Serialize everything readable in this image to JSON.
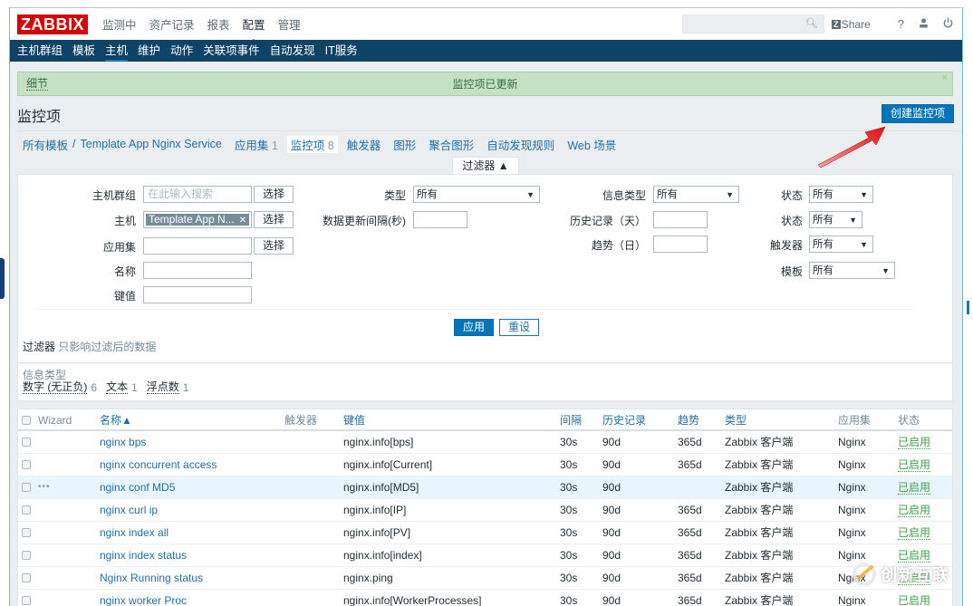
{
  "header": {
    "logo": "ZABBIX",
    "main_menu": [
      "监测中",
      "资产记录",
      "报表",
      "配置",
      "管理"
    ],
    "active_main": "配置",
    "search_placeholder": "",
    "share_label": "Share",
    "share_badge": "Z",
    "help_label": "?"
  },
  "subnav": {
    "items": [
      "主机群组",
      "模板",
      "主机",
      "维护",
      "动作",
      "关联项事件",
      "自动发现",
      "IT服务"
    ],
    "active": "主机"
  },
  "message": {
    "details_label": "细节",
    "text": "监控项已更新",
    "close": "×"
  },
  "page": {
    "title": "监控项",
    "create_button": "创建监控项"
  },
  "breadcrumb": {
    "all_templates": "所有模板",
    "separator": "/",
    "template": "Template App Nginx Service",
    "tabs": [
      {
        "label": "应用集",
        "count": "1"
      },
      {
        "label": "监控项",
        "count": "8",
        "current": true
      },
      {
        "label": "触发器",
        "count": ""
      },
      {
        "label": "图形",
        "count": ""
      },
      {
        "label": "聚合图形",
        "count": ""
      },
      {
        "label": "自动发现规则",
        "count": ""
      },
      {
        "label": "Web 场景",
        "count": ""
      }
    ]
  },
  "filter": {
    "tab_label": "过滤器 ▲",
    "host_group_label": "主机群组",
    "host_group_placeholder": "在此输入搜索",
    "select_label": "选择",
    "host_label": "主机",
    "host_chip": "Template App N...",
    "application_label": "应用集",
    "name_label": "名称",
    "key_label": "键值",
    "type_label": "类型",
    "type_value": "所有",
    "interval_label": "数据更新间隔(秒)",
    "info_type_label": "信息类型",
    "info_type_value": "所有",
    "history_label": "历史记录（天）",
    "trends_label": "趋势（日）",
    "state_label": "状态",
    "state_value": "所有",
    "status_label": "状态",
    "status_value": "所有",
    "triggers_label": "触发器",
    "triggers_value": "所有",
    "template_label": "模板",
    "template_value": "所有",
    "apply_label": "应用",
    "reset_label": "重设",
    "note_a": "过滤器",
    "note_b": "只影响过滤后的数据"
  },
  "info_type_summary": {
    "title": "信息类型",
    "items": [
      {
        "label": "数字 (无正负)",
        "count": "6"
      },
      {
        "label": "文本",
        "count": "1"
      },
      {
        "label": "浮点数",
        "count": "1"
      }
    ]
  },
  "table": {
    "columns": {
      "wizard": "Wizard",
      "name": "名称▲",
      "triggers": "触发器",
      "key": "键值",
      "interval": "间隔",
      "history": "历史记录",
      "trends": "趋势",
      "type": "类型",
      "applications": "应用集",
      "status": "状态"
    },
    "rows": [
      {
        "wizard": "",
        "name": "nginx bps",
        "triggers": "",
        "key": "nginx.info[bps]",
        "interval": "30s",
        "history": "90d",
        "trends": "365d",
        "type": "Zabbix 客户端",
        "applications": "Nginx",
        "status": "已启用"
      },
      {
        "wizard": "",
        "name": "nginx concurrent access",
        "triggers": "",
        "key": "nginx.info[Current]",
        "interval": "30s",
        "history": "90d",
        "trends": "365d",
        "type": "Zabbix 客户端",
        "applications": "Nginx",
        "status": "已启用"
      },
      {
        "wizard": "•••",
        "name": "nginx conf MD5",
        "triggers": "",
        "key": "nginx.info[MD5]",
        "interval": "30s",
        "history": "90d",
        "trends": "",
        "type": "Zabbix 客户端",
        "applications": "Nginx",
        "status": "已启用",
        "highlighted": true
      },
      {
        "wizard": "",
        "name": "nginx curl ip",
        "triggers": "",
        "key": "nginx.info[IP]",
        "interval": "30s",
        "history": "90d",
        "trends": "365d",
        "type": "Zabbix 客户端",
        "applications": "Nginx",
        "status": "已启用"
      },
      {
        "wizard": "",
        "name": "nginx index all",
        "triggers": "",
        "key": "nginx.info[PV]",
        "interval": "30s",
        "history": "90d",
        "trends": "365d",
        "type": "Zabbix 客户端",
        "applications": "Nginx",
        "status": "已启用"
      },
      {
        "wizard": "",
        "name": "nginx index status",
        "triggers": "",
        "key": "nginx.info[index]",
        "interval": "30s",
        "history": "90d",
        "trends": "365d",
        "type": "Zabbix 客户端",
        "applications": "Nginx",
        "status": "已启用"
      },
      {
        "wizard": "",
        "name": "Nginx Running status",
        "triggers": "",
        "key": "nginx.ping",
        "interval": "30s",
        "history": "90d",
        "trends": "365d",
        "type": "Zabbix 客户端",
        "applications": "Nginx",
        "status": "已启用"
      },
      {
        "wizard": "",
        "name": "nginx worker Proc",
        "triggers": "",
        "key": "nginx.info[WorkerProcesses]",
        "interval": "30s",
        "history": "90d",
        "trends": "365d",
        "type": "Zabbix 客户端",
        "applications": "Nginx",
        "status": "已启用"
      }
    ]
  },
  "watermark": {
    "text": "创新互联"
  },
  "colors": {
    "logo_red": "#d40000",
    "nav_dark_blue": "#0e4367",
    "link_blue": "#1f6fa8",
    "primary_button": "#0275b8",
    "success_bg": "#c3e2c5",
    "status_green": "#429e47",
    "annotation_arrow": "#e32222"
  }
}
